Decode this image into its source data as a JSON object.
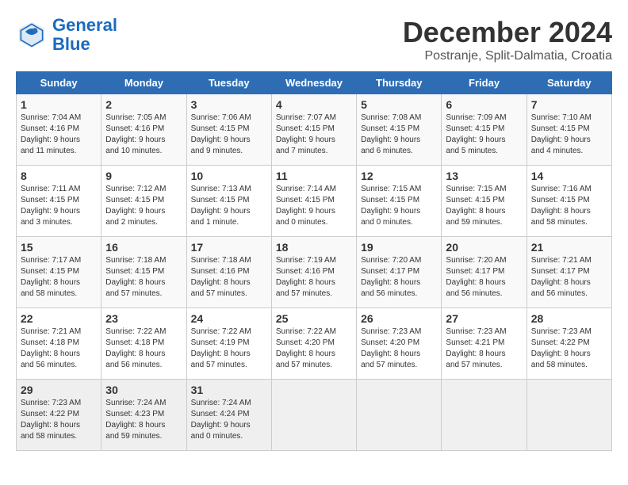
{
  "logo": {
    "line1": "General",
    "line2": "Blue"
  },
  "title": "December 2024",
  "subtitle": "Postranje, Split-Dalmatia, Croatia",
  "weekdays": [
    "Sunday",
    "Monday",
    "Tuesday",
    "Wednesday",
    "Thursday",
    "Friday",
    "Saturday"
  ],
  "weeks": [
    [
      {
        "day": "1",
        "info": "Sunrise: 7:04 AM\nSunset: 4:16 PM\nDaylight: 9 hours\nand 11 minutes."
      },
      {
        "day": "2",
        "info": "Sunrise: 7:05 AM\nSunset: 4:16 PM\nDaylight: 9 hours\nand 10 minutes."
      },
      {
        "day": "3",
        "info": "Sunrise: 7:06 AM\nSunset: 4:15 PM\nDaylight: 9 hours\nand 9 minutes."
      },
      {
        "day": "4",
        "info": "Sunrise: 7:07 AM\nSunset: 4:15 PM\nDaylight: 9 hours\nand 7 minutes."
      },
      {
        "day": "5",
        "info": "Sunrise: 7:08 AM\nSunset: 4:15 PM\nDaylight: 9 hours\nand 6 minutes."
      },
      {
        "day": "6",
        "info": "Sunrise: 7:09 AM\nSunset: 4:15 PM\nDaylight: 9 hours\nand 5 minutes."
      },
      {
        "day": "7",
        "info": "Sunrise: 7:10 AM\nSunset: 4:15 PM\nDaylight: 9 hours\nand 4 minutes."
      }
    ],
    [
      {
        "day": "8",
        "info": "Sunrise: 7:11 AM\nSunset: 4:15 PM\nDaylight: 9 hours\nand 3 minutes."
      },
      {
        "day": "9",
        "info": "Sunrise: 7:12 AM\nSunset: 4:15 PM\nDaylight: 9 hours\nand 2 minutes."
      },
      {
        "day": "10",
        "info": "Sunrise: 7:13 AM\nSunset: 4:15 PM\nDaylight: 9 hours\nand 1 minute."
      },
      {
        "day": "11",
        "info": "Sunrise: 7:14 AM\nSunset: 4:15 PM\nDaylight: 9 hours\nand 0 minutes."
      },
      {
        "day": "12",
        "info": "Sunrise: 7:15 AM\nSunset: 4:15 PM\nDaylight: 9 hours\nand 0 minutes."
      },
      {
        "day": "13",
        "info": "Sunrise: 7:15 AM\nSunset: 4:15 PM\nDaylight: 8 hours\nand 59 minutes."
      },
      {
        "day": "14",
        "info": "Sunrise: 7:16 AM\nSunset: 4:15 PM\nDaylight: 8 hours\nand 58 minutes."
      }
    ],
    [
      {
        "day": "15",
        "info": "Sunrise: 7:17 AM\nSunset: 4:15 PM\nDaylight: 8 hours\nand 58 minutes."
      },
      {
        "day": "16",
        "info": "Sunrise: 7:18 AM\nSunset: 4:15 PM\nDaylight: 8 hours\nand 57 minutes."
      },
      {
        "day": "17",
        "info": "Sunrise: 7:18 AM\nSunset: 4:16 PM\nDaylight: 8 hours\nand 57 minutes."
      },
      {
        "day": "18",
        "info": "Sunrise: 7:19 AM\nSunset: 4:16 PM\nDaylight: 8 hours\nand 57 minutes."
      },
      {
        "day": "19",
        "info": "Sunrise: 7:20 AM\nSunset: 4:17 PM\nDaylight: 8 hours\nand 56 minutes."
      },
      {
        "day": "20",
        "info": "Sunrise: 7:20 AM\nSunset: 4:17 PM\nDaylight: 8 hours\nand 56 minutes."
      },
      {
        "day": "21",
        "info": "Sunrise: 7:21 AM\nSunset: 4:17 PM\nDaylight: 8 hours\nand 56 minutes."
      }
    ],
    [
      {
        "day": "22",
        "info": "Sunrise: 7:21 AM\nSunset: 4:18 PM\nDaylight: 8 hours\nand 56 minutes."
      },
      {
        "day": "23",
        "info": "Sunrise: 7:22 AM\nSunset: 4:18 PM\nDaylight: 8 hours\nand 56 minutes."
      },
      {
        "day": "24",
        "info": "Sunrise: 7:22 AM\nSunset: 4:19 PM\nDaylight: 8 hours\nand 57 minutes."
      },
      {
        "day": "25",
        "info": "Sunrise: 7:22 AM\nSunset: 4:20 PM\nDaylight: 8 hours\nand 57 minutes."
      },
      {
        "day": "26",
        "info": "Sunrise: 7:23 AM\nSunset: 4:20 PM\nDaylight: 8 hours\nand 57 minutes."
      },
      {
        "day": "27",
        "info": "Sunrise: 7:23 AM\nSunset: 4:21 PM\nDaylight: 8 hours\nand 57 minutes."
      },
      {
        "day": "28",
        "info": "Sunrise: 7:23 AM\nSunset: 4:22 PM\nDaylight: 8 hours\nand 58 minutes."
      }
    ],
    [
      {
        "day": "29",
        "info": "Sunrise: 7:23 AM\nSunset: 4:22 PM\nDaylight: 8 hours\nand 58 minutes."
      },
      {
        "day": "30",
        "info": "Sunrise: 7:24 AM\nSunset: 4:23 PM\nDaylight: 8 hours\nand 59 minutes."
      },
      {
        "day": "31",
        "info": "Sunrise: 7:24 AM\nSunset: 4:24 PM\nDaylight: 9 hours\nand 0 minutes."
      },
      {
        "day": "",
        "info": ""
      },
      {
        "day": "",
        "info": ""
      },
      {
        "day": "",
        "info": ""
      },
      {
        "day": "",
        "info": ""
      }
    ]
  ]
}
